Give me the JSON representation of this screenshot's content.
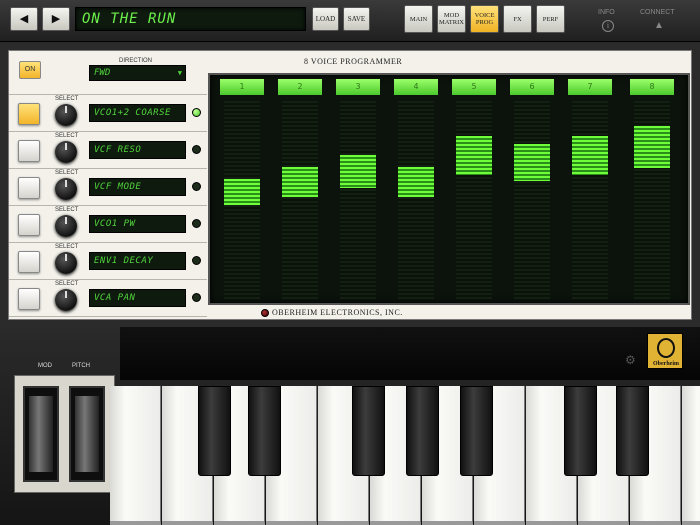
{
  "header": {
    "back_label": "◀",
    "forward_label": "▶",
    "patch_name": "ON THE RUN",
    "load_label": "LOAD",
    "save_label": "SAVE",
    "pages": [
      {
        "line1": "MAIN",
        "line2": "",
        "active": false
      },
      {
        "line1": "MOD",
        "line2": "MATRIX",
        "active": false
      },
      {
        "line1": "VOICE",
        "line2": "PROG",
        "active": true
      },
      {
        "line1": "FX",
        "line2": "",
        "active": false
      },
      {
        "line1": "PERF",
        "line2": "",
        "active": false
      }
    ],
    "info_label": "INFO",
    "connect_label": "CONNECT"
  },
  "programmer": {
    "on_label": "ON",
    "direction_label": "DIRECTION",
    "direction_value": "FWD",
    "select_label": "SELECT",
    "title": "8 VOICE PROGRAMMER",
    "rows": [
      {
        "param": "VCO1+2 COARSE",
        "lit": true,
        "led_on": true
      },
      {
        "param": "VCF RESO",
        "lit": false,
        "led_on": false
      },
      {
        "param": "VCF MODE",
        "lit": false,
        "led_on": false
      },
      {
        "param": "VCO1 PW",
        "lit": false,
        "led_on": false
      },
      {
        "param": "ENV1 DECAY",
        "lit": false,
        "led_on": false
      },
      {
        "param": "VCA PAN",
        "lit": false,
        "led_on": false
      }
    ],
    "voices": [
      {
        "label": "1",
        "level": 0.1
      },
      {
        "label": "2",
        "level": 0.16
      },
      {
        "label": "3",
        "level": 0.22
      },
      {
        "label": "4",
        "level": 0.16
      },
      {
        "label": "5",
        "level": 0.32
      },
      {
        "label": "6",
        "level": 0.28
      },
      {
        "label": "7",
        "level": 0.32
      },
      {
        "label": "8",
        "level": 0.37
      }
    ],
    "maker": "OBERHEIM ELECTRONICS, INC."
  },
  "keyboard": {
    "mod_label": "MOD",
    "pitch_label": "PITCH",
    "logo_text": "Oberheim"
  },
  "colors": {
    "lcd_green": "#4fd43a",
    "active_yellow": "#f3b42a"
  }
}
